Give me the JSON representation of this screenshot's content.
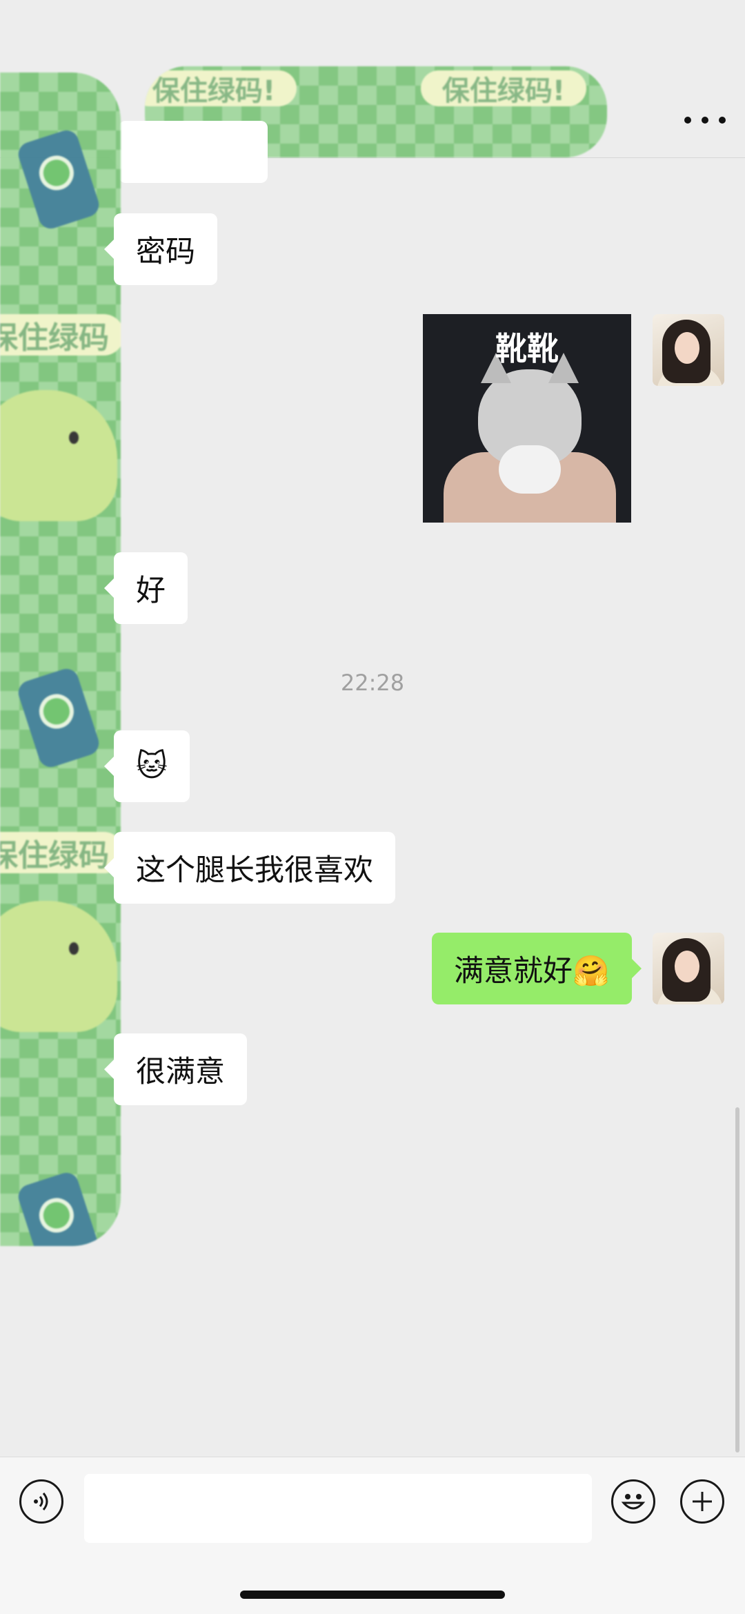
{
  "header": {
    "menu_icon": "more-dots-icon"
  },
  "stickers": {
    "top_banner_text": "保住绿码!",
    "left_banner_text": "保住绿码"
  },
  "messages": [
    {
      "side": "left",
      "text": "密码"
    },
    {
      "side": "right",
      "type": "sticker",
      "caption": "靴靴"
    },
    {
      "side": "left",
      "text": "好"
    },
    {
      "side": "left",
      "type": "emoji",
      "text": "🐱"
    },
    {
      "side": "left",
      "text": "这个腿长我很喜欢"
    },
    {
      "side": "right",
      "text": "满意就好🤗"
    },
    {
      "side": "left",
      "text": "很满意"
    }
  ],
  "timestamp": "22:28",
  "input": {
    "voice_icon": "voice-icon",
    "emoji_icon": "smile-icon",
    "plus_icon": "plus-icon",
    "placeholder": ""
  }
}
